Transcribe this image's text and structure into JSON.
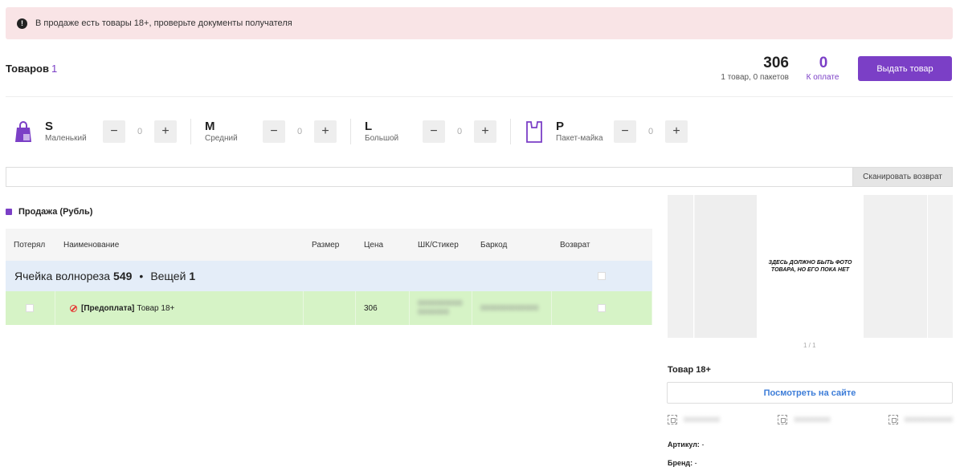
{
  "alert": {
    "text": "В продаже есть товары 18+, проверьте документы получателя",
    "icon": "exclamation-icon"
  },
  "header": {
    "items_label": "Товаров",
    "items_count": "1",
    "total_amount": "306",
    "total_sub": "1 товар, 0 пакетов",
    "to_pay_amount": "0",
    "to_pay_label": "К оплате",
    "issue_button": "Выдать товар"
  },
  "packages": [
    {
      "size": "S",
      "name": "Маленький",
      "value": "0",
      "icon": "shopping-bag-icon"
    },
    {
      "size": "M",
      "name": "Средний",
      "value": "0",
      "icon": ""
    },
    {
      "size": "L",
      "name": "Большой",
      "value": "0",
      "icon": ""
    },
    {
      "size": "P",
      "name": "Пакет-майка",
      "value": "0",
      "icon": "t-shirt-bag-icon"
    }
  ],
  "stepper": {
    "minus": "−",
    "plus": "+"
  },
  "scan": {
    "input_value": "",
    "button": "Сканировать возврат"
  },
  "sale": {
    "title": "Продажа (Рубль)"
  },
  "table": {
    "columns": [
      "Потерял",
      "Наименование",
      "Размер",
      "Цена",
      "ШК/Стикер",
      "Баркод",
      "Возврат"
    ],
    "group": {
      "prefix": "Ячейка волнореза",
      "cell": "549",
      "sep": "•",
      "things_label": "Вещей",
      "things_count": "1"
    },
    "rows": [
      {
        "prepay_tag": "[Предоплата]",
        "name": "Товар 18+",
        "size": "",
        "price": "306",
        "sticker": "0000000000 0000000",
        "barcode": "0000000000000"
      }
    ]
  },
  "photo": {
    "placeholder": "ЗДЕСЬ ДОЛЖНО БЫТЬ ФОТО ТОВАРА, НО ЕГО ПОКА НЕТ",
    "pager": "1 / 1"
  },
  "product": {
    "name": "Товар 18+",
    "view_button": "Посмотреть на сайте",
    "codes": [
      "000000000",
      "000000000",
      "000000000000"
    ],
    "article_label": "Артикул:",
    "article_value": "-",
    "brand_label": "Бренд:",
    "brand_value": "-"
  },
  "colors": {
    "accent": "#7b3fc6",
    "alert_bg": "#f9e4e6",
    "group_bg": "#e4edf8",
    "row_bg": "#d6f3c6",
    "link": "#3d7dd8"
  }
}
